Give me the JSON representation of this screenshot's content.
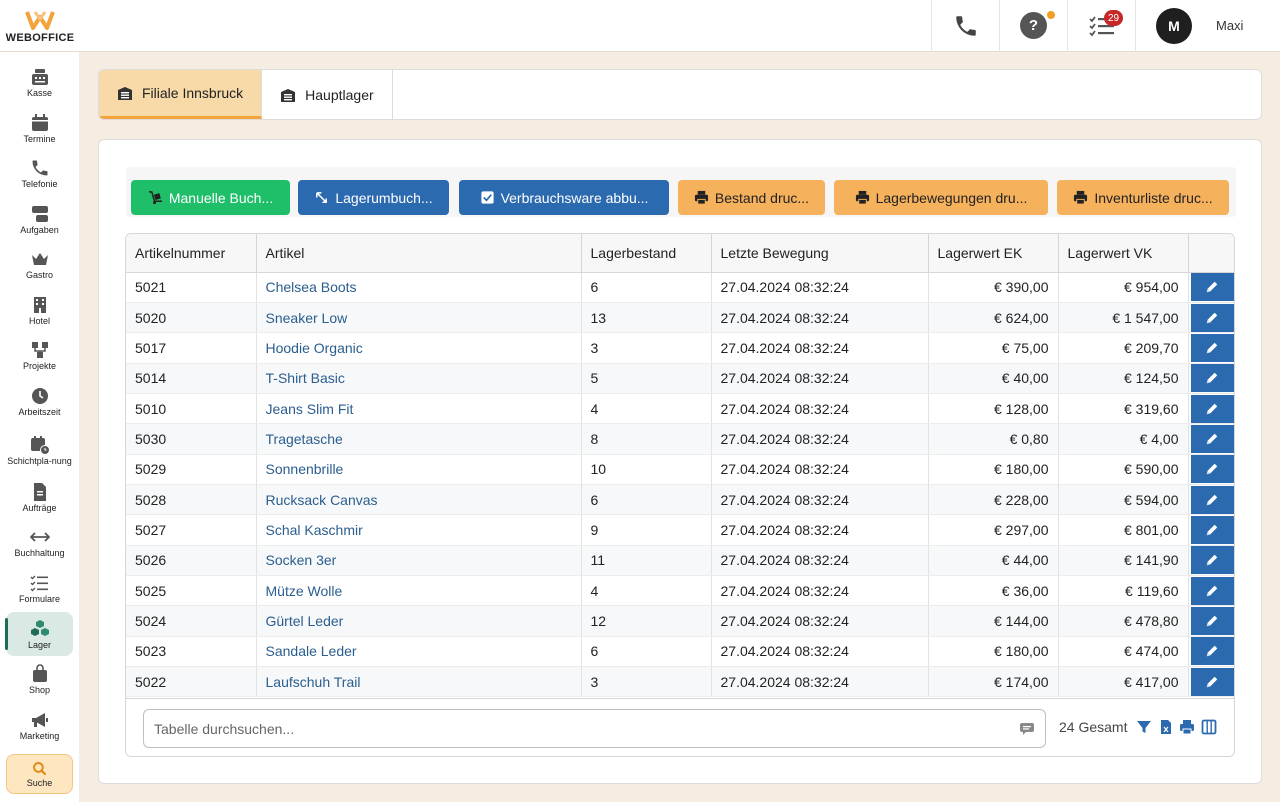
{
  "brand": {
    "name": "WEBOFFICE",
    "accent": "#f3a33a"
  },
  "header": {
    "phone_icon": "phone-icon",
    "help_icon": "help-icon",
    "tasks_badge": "29",
    "user_initial": "M",
    "user_name": "Maxi"
  },
  "sidebar": {
    "items": [
      {
        "label": "Kasse",
        "icon": "cash-register-icon"
      },
      {
        "label": "Termine",
        "icon": "calendar-icon"
      },
      {
        "label": "Telefonie",
        "icon": "phone-icon"
      },
      {
        "label": "Aufgaben",
        "icon": "tasks-icon"
      },
      {
        "label": "Gastro",
        "icon": "crown-icon"
      },
      {
        "label": "Hotel",
        "icon": "hotel-icon"
      },
      {
        "label": "Projekte",
        "icon": "project-icon"
      },
      {
        "label": "Arbeitszeit",
        "icon": "clock-icon"
      },
      {
        "label": "Schichtpla-nung",
        "icon": "shift-calendar-icon"
      },
      {
        "label": "Aufträge",
        "icon": "document-icon"
      },
      {
        "label": "Buchhaltung",
        "icon": "arrows-icon"
      },
      {
        "label": "Formulare",
        "icon": "list-icon"
      },
      {
        "label": "Lager",
        "icon": "boxes-icon"
      },
      {
        "label": "Shop",
        "icon": "bag-icon"
      },
      {
        "label": "Marketing",
        "icon": "megaphone-icon"
      },
      {
        "label": "Suche",
        "icon": "search-icon"
      }
    ]
  },
  "tabs": [
    {
      "label": "Filiale Innsbruck",
      "active": true
    },
    {
      "label": "Hauptlager",
      "active": false
    }
  ],
  "toolbar": {
    "manual_booking": "Manuelle Buch...",
    "relocation": "Lagerumbuch...",
    "consumables": "Verbrauchsware abbu...",
    "print_stock": "Bestand druc...",
    "print_movements": "Lagerbewegungen dru...",
    "print_inventory": "Inventurliste druc..."
  },
  "table": {
    "columns": [
      "Artikelnummer",
      "Artikel",
      "Lagerbestand",
      "Letzte Bewegung",
      "Lagerwert EK",
      "Lagerwert VK"
    ],
    "rows": [
      [
        "5021",
        "Chelsea Boots",
        "6",
        "27.04.2024 08:32:24",
        "€ 390,00",
        "€ 954,00"
      ],
      [
        "5020",
        "Sneaker Low",
        "13",
        "27.04.2024 08:32:24",
        "€ 624,00",
        "€ 1 547,00"
      ],
      [
        "5017",
        "Hoodie Organic",
        "3",
        "27.04.2024 08:32:24",
        "€ 75,00",
        "€ 209,70"
      ],
      [
        "5014",
        "T-Shirt Basic",
        "5",
        "27.04.2024 08:32:24",
        "€ 40,00",
        "€ 124,50"
      ],
      [
        "5010",
        "Jeans Slim Fit",
        "4",
        "27.04.2024 08:32:24",
        "€ 128,00",
        "€ 319,60"
      ],
      [
        "5030",
        "Tragetasche",
        "8",
        "27.04.2024 08:32:24",
        "€ 0,80",
        "€ 4,00"
      ],
      [
        "5029",
        "Sonnenbrille",
        "10",
        "27.04.2024 08:32:24",
        "€ 180,00",
        "€ 590,00"
      ],
      [
        "5028",
        "Rucksack Canvas",
        "6",
        "27.04.2024 08:32:24",
        "€ 228,00",
        "€ 594,00"
      ],
      [
        "5027",
        "Schal Kaschmir",
        "9",
        "27.04.2024 08:32:24",
        "€ 297,00",
        "€ 801,00"
      ],
      [
        "5026",
        "Socken 3er",
        "11",
        "27.04.2024 08:32:24",
        "€ 44,00",
        "€ 141,90"
      ],
      [
        "5025",
        "Mütze Wolle",
        "4",
        "27.04.2024 08:32:24",
        "€ 36,00",
        "€ 119,60"
      ],
      [
        "5024",
        "Gürtel Leder",
        "12",
        "27.04.2024 08:32:24",
        "€ 144,00",
        "€ 478,80"
      ],
      [
        "5023",
        "Sandale Leder",
        "6",
        "27.04.2024 08:32:24",
        "€ 180,00",
        "€ 474,00"
      ],
      [
        "5022",
        "Laufschuh Trail",
        "3",
        "27.04.2024 08:32:24",
        "€ 174,00",
        "€ 417,00"
      ]
    ]
  },
  "footer": {
    "search_placeholder": "Tabelle durchsuchen...",
    "total": "24 Gesamt"
  }
}
